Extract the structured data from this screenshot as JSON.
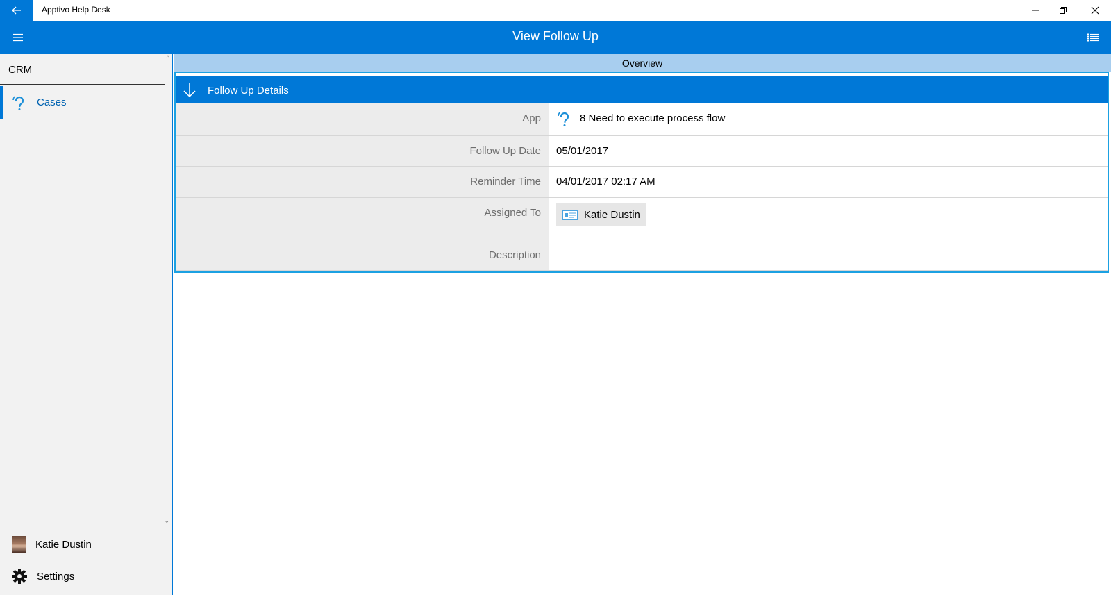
{
  "window": {
    "title": "Apptivo Help Desk"
  },
  "header": {
    "title": "View Follow Up"
  },
  "sidebar": {
    "section": "CRM",
    "items": [
      {
        "label": "Cases",
        "icon": "help-ear-icon"
      }
    ],
    "user": "Katie Dustin",
    "settings": "Settings"
  },
  "overview": {
    "label": "Overview"
  },
  "details": {
    "title": "Follow Up Details",
    "fields": {
      "app": {
        "label": "App",
        "value": "8 Need to execute process flow"
      },
      "follow_up_date": {
        "label": "Follow Up Date",
        "value": "05/01/2017"
      },
      "reminder_time": {
        "label": "Reminder Time",
        "value": "04/01/2017 02:17 AM"
      },
      "assigned_to": {
        "label": "Assigned To",
        "value": "Katie Dustin"
      },
      "description": {
        "label": "Description",
        "value": ""
      }
    }
  },
  "colors": {
    "accent": "#0078d7",
    "overview": "#a8ceef",
    "label_bg": "#ececec",
    "focus_border": "#1ba1e2"
  }
}
